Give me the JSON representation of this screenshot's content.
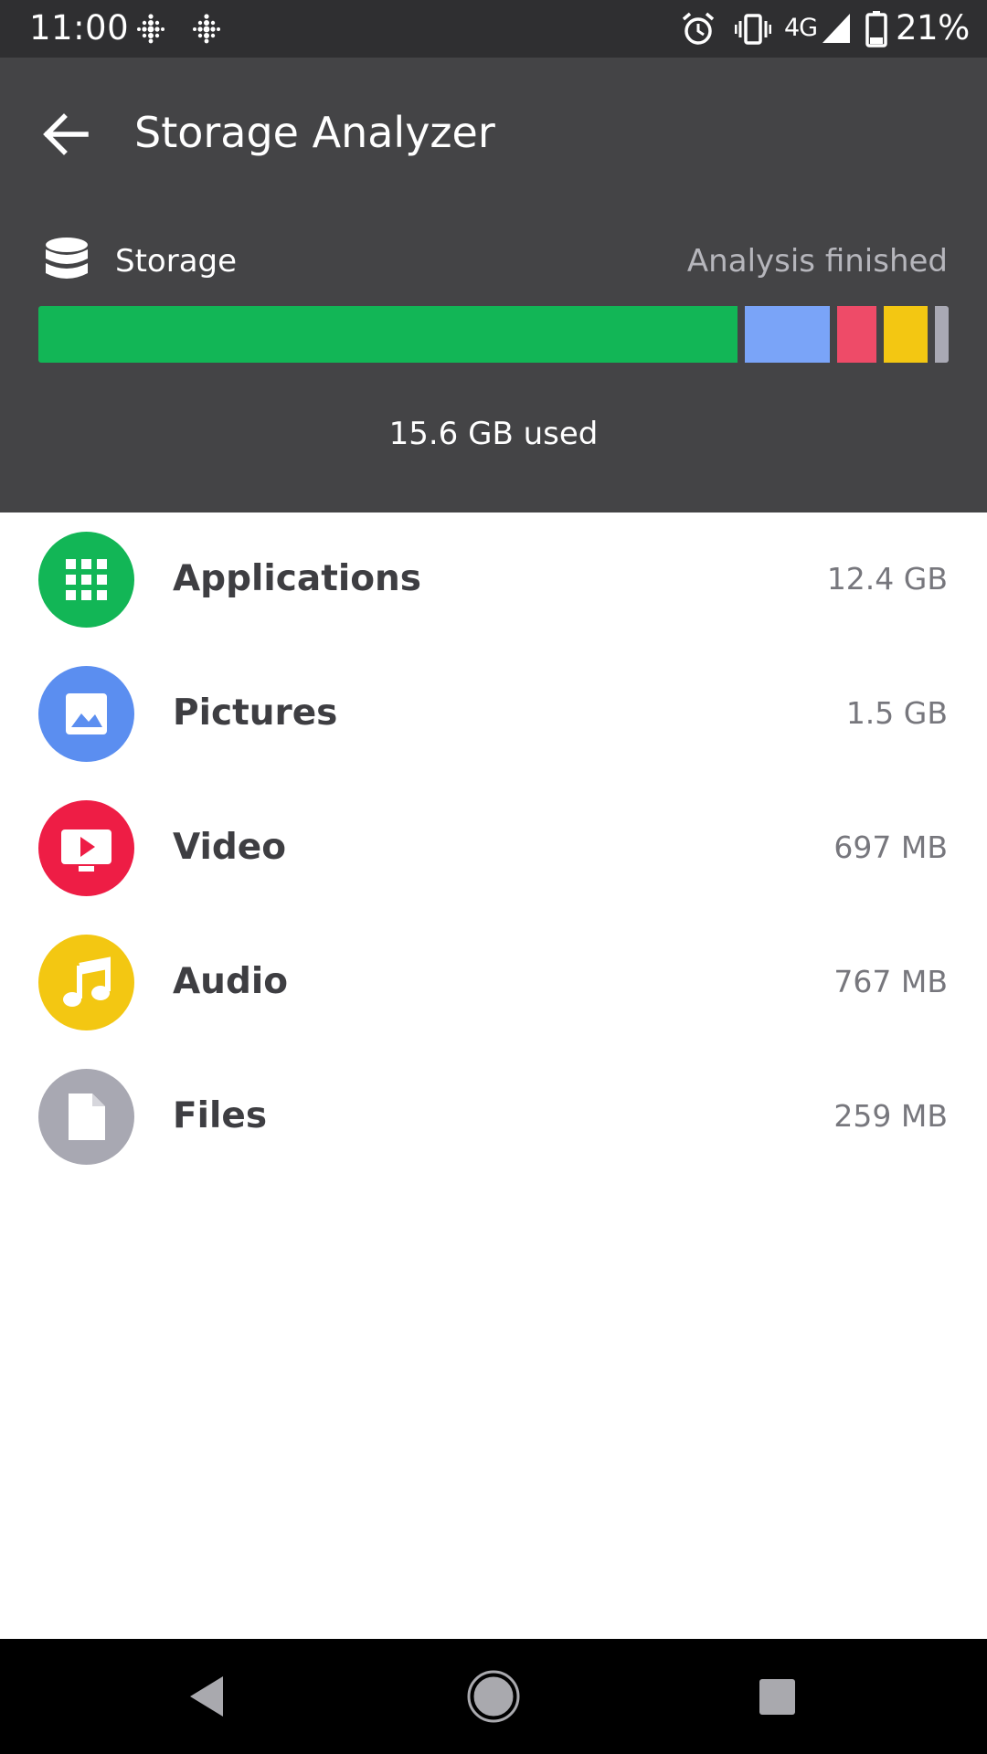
{
  "status_bar": {
    "time": "11:00",
    "network": "4G",
    "battery": "21%",
    "icons": [
      "fitbit-icon",
      "fitbit-icon",
      "alarm-icon",
      "vibrate-icon",
      "signal-icon",
      "battery-icon"
    ]
  },
  "app_bar": {
    "title": "Storage Analyzer",
    "back_icon": "arrow-left-icon"
  },
  "storage": {
    "label": "Storage",
    "icon": "database-icon",
    "status": "Analysis finished",
    "used_label": "15.6 GB used",
    "segments": [
      {
        "category": "Applications",
        "fraction": 0.772,
        "color": "#12b656"
      },
      {
        "category": "Pictures",
        "fraction": 0.094,
        "color": "#7aa4f8"
      },
      {
        "category": "Video",
        "fraction": 0.043,
        "color": "#ee4b68"
      },
      {
        "category": "Audio",
        "fraction": 0.048,
        "color": "#f3c712"
      },
      {
        "category": "Files",
        "fraction": 0.016,
        "color": "#a9a9b4"
      }
    ]
  },
  "categories": [
    {
      "name": "Applications",
      "size": "12.4 GB",
      "icon": "apps-grid-icon",
      "color": "#12b656"
    },
    {
      "name": "Pictures",
      "size": "1.5 GB",
      "icon": "image-icon",
      "color": "#5b8ef0"
    },
    {
      "name": "Video",
      "size": "697 MB",
      "icon": "video-play-icon",
      "color": "#ee1d45"
    },
    {
      "name": "Audio",
      "size": "767 MB",
      "icon": "music-note-icon",
      "color": "#f3c712"
    },
    {
      "name": "Files",
      "size": "259 MB",
      "icon": "file-icon",
      "color": "#a8a8b2"
    }
  ],
  "nav_bar": {
    "buttons": [
      "back-triangle-icon",
      "home-circle-icon",
      "recents-square-icon"
    ]
  }
}
